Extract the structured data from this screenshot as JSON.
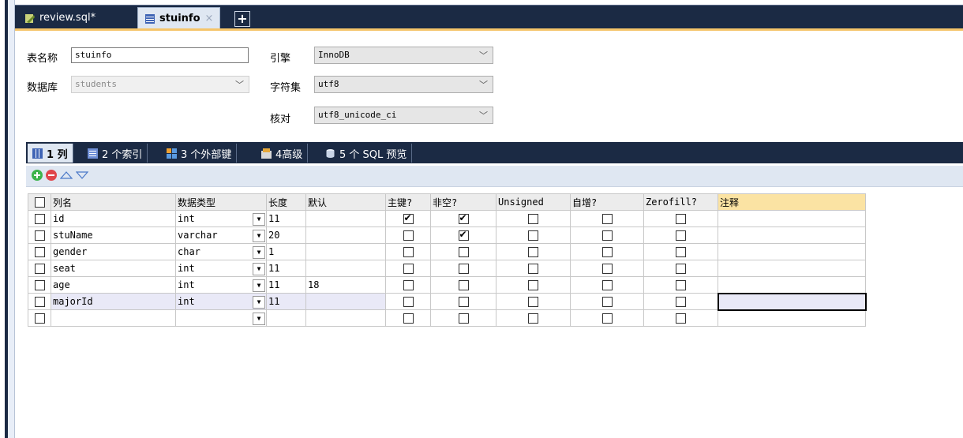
{
  "tabs": [
    {
      "label": "review.sql*",
      "icon": "sql-file-icon",
      "active": false
    },
    {
      "label": "stuinfo",
      "icon": "table-icon",
      "active": true,
      "close": "×"
    }
  ],
  "tab_add": "+",
  "form": {
    "table_name_label": "表名称",
    "table_name_value": "stuinfo",
    "database_label": "数据库",
    "database_value": "students",
    "engine_label": "引擎",
    "engine_value": "InnoDB",
    "charset_label": "字符集",
    "charset_value": "utf8",
    "collation_label": "核对",
    "collation_value": "utf8_unicode_ci"
  },
  "subtabs": [
    {
      "label": "1 列",
      "active": true
    },
    {
      "label": "2 个索引",
      "active": false
    },
    {
      "label": "3 个外部键",
      "active": false
    },
    {
      "label": "4高级",
      "active": false
    },
    {
      "label": "5 个 SQL 预览",
      "active": false
    }
  ],
  "grid": {
    "headers": [
      "列名",
      "数据类型",
      "长度",
      "默认",
      "主键?",
      "非空?",
      "Unsigned",
      "自增?",
      "Zerofill?",
      "注释"
    ],
    "rows": [
      {
        "name": "id",
        "type": "int",
        "length": "11",
        "default": "",
        "pk": true,
        "nn": true,
        "unsigned": false,
        "ai": false,
        "zf": false,
        "comment": ""
      },
      {
        "name": "stuName",
        "type": "varchar",
        "length": "20",
        "default": "",
        "pk": false,
        "nn": true,
        "unsigned": false,
        "ai": false,
        "zf": false,
        "comment": ""
      },
      {
        "name": "gender",
        "type": "char",
        "length": "1",
        "default": "",
        "pk": false,
        "nn": false,
        "unsigned": false,
        "ai": false,
        "zf": false,
        "comment": ""
      },
      {
        "name": "seat",
        "type": "int",
        "length": "11",
        "default": "",
        "pk": false,
        "nn": false,
        "unsigned": false,
        "ai": false,
        "zf": false,
        "comment": ""
      },
      {
        "name": "age",
        "type": "int",
        "length": "11",
        "default": "18",
        "pk": false,
        "nn": false,
        "unsigned": false,
        "ai": false,
        "zf": false,
        "comment": ""
      },
      {
        "name": "majorId",
        "type": "int",
        "length": "11",
        "default": "",
        "pk": false,
        "nn": false,
        "unsigned": false,
        "ai": false,
        "zf": false,
        "comment": ""
      },
      {
        "name": "",
        "type": "",
        "length": "",
        "default": "",
        "pk": false,
        "nn": false,
        "unsigned": false,
        "ai": false,
        "zf": false,
        "comment": ""
      }
    ]
  },
  "colors": {
    "dark_bar": "#1b2a44",
    "accent": "#f5c46a",
    "panel": "#dfe7f2"
  }
}
